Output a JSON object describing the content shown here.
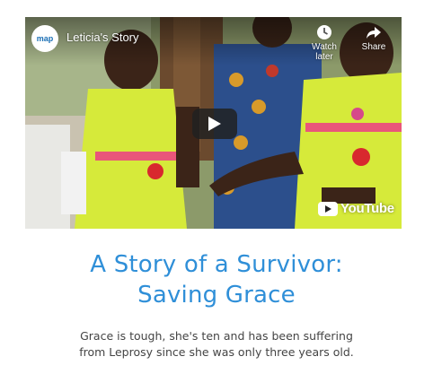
{
  "video": {
    "channel_logo_text": "map",
    "title": "Leticia's Story",
    "watch_later_label": "Watch later",
    "share_label": "Share",
    "youtube_label": "YouTube",
    "icons": [
      "clock-icon",
      "share-arrow-icon",
      "play-icon",
      "youtube-logo-icon"
    ]
  },
  "article": {
    "heading_line1": "A Story of a Survivor:",
    "heading_line2": "Saving Grace",
    "body_line1": "Grace is tough, she's ten and has been suffering",
    "body_line2": "from Leprosy since she was only three years old."
  },
  "colors": {
    "heading": "#2f8fd8",
    "body_text": "#444444",
    "dress": "#d6ea3a"
  }
}
